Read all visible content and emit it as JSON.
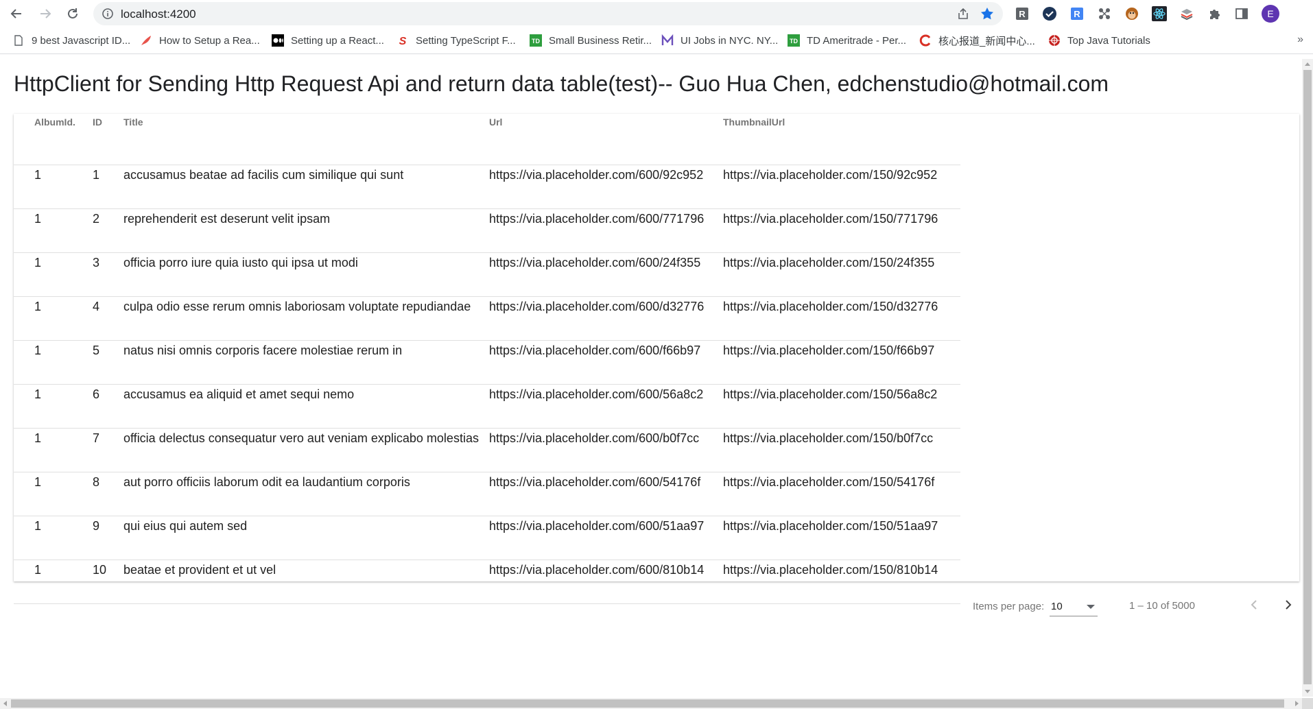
{
  "browser": {
    "url": "localhost:4200",
    "profile_initial": "E",
    "accent_color": "#1a73e8",
    "extensions": [
      "r-icon",
      "check-circle-icon",
      "r-blue-icon",
      "network-icon",
      "monkey-icon",
      "react-icon",
      "stack-icon",
      "puzzle-icon",
      "sidepanel-icon"
    ]
  },
  "bookmarks": [
    {
      "label": "9 best Javascript ID...",
      "icon": "document-icon"
    },
    {
      "label": "How to Setup a Rea...",
      "icon": "feather-icon"
    },
    {
      "label": "Setting up a React...",
      "icon": "medium-icon"
    },
    {
      "label": "Setting TypeScript F...",
      "icon": "s-icon"
    },
    {
      "label": "Small Business Retir...",
      "icon": "td-icon"
    },
    {
      "label": "UI Jobs in NYC. NY...",
      "icon": "m-icon"
    },
    {
      "label": "TD Ameritrade - Per...",
      "icon": "td-icon"
    },
    {
      "label": "核心报道_新闻中心...",
      "icon": "c-icon"
    },
    {
      "label": "Top Java Tutorials",
      "icon": "globe-icon"
    }
  ],
  "bookmarks_more": "»",
  "page": {
    "title": "HttpClient for Sending Http Request Api and return data table(test)-- Guo Hua Chen, edchenstudio@hotmail.com"
  },
  "table": {
    "headers": [
      "AlbumId.",
      "ID",
      "Title",
      "Url",
      "ThumbnailUrl"
    ],
    "rows": [
      [
        "1",
        "1",
        "accusamus beatae ad facilis cum similique qui sunt",
        "https://via.placeholder.com/600/92c952",
        "https://via.placeholder.com/150/92c952"
      ],
      [
        "1",
        "2",
        "reprehenderit est deserunt velit ipsam",
        "https://via.placeholder.com/600/771796",
        "https://via.placeholder.com/150/771796"
      ],
      [
        "1",
        "3",
        "officia porro iure quia iusto qui ipsa ut modi",
        "https://via.placeholder.com/600/24f355",
        "https://via.placeholder.com/150/24f355"
      ],
      [
        "1",
        "4",
        "culpa odio esse rerum omnis laboriosam voluptate repudiandae",
        "https://via.placeholder.com/600/d32776",
        "https://via.placeholder.com/150/d32776"
      ],
      [
        "1",
        "5",
        "natus nisi omnis corporis facere molestiae rerum in",
        "https://via.placeholder.com/600/f66b97",
        "https://via.placeholder.com/150/f66b97"
      ],
      [
        "1",
        "6",
        "accusamus ea aliquid et amet sequi nemo",
        "https://via.placeholder.com/600/56a8c2",
        "https://via.placeholder.com/150/56a8c2"
      ],
      [
        "1",
        "7",
        "officia delectus consequatur vero aut veniam explicabo molestias",
        "https://via.placeholder.com/600/b0f7cc",
        "https://via.placeholder.com/150/b0f7cc"
      ],
      [
        "1",
        "8",
        "aut porro officiis laborum odit ea laudantium corporis",
        "https://via.placeholder.com/600/54176f",
        "https://via.placeholder.com/150/54176f"
      ],
      [
        "1",
        "9",
        "qui eius qui autem sed",
        "https://via.placeholder.com/600/51aa97",
        "https://via.placeholder.com/150/51aa97"
      ],
      [
        "1",
        "10",
        "beatae et provident et ut vel",
        "https://via.placeholder.com/600/810b14",
        "https://via.placeholder.com/150/810b14"
      ]
    ]
  },
  "paginator": {
    "label": "Items per page:",
    "page_size": "10",
    "range": "1 – 10 of 5000",
    "prev_icon": "chevron-left-icon",
    "next_icon": "chevron-right-icon"
  }
}
